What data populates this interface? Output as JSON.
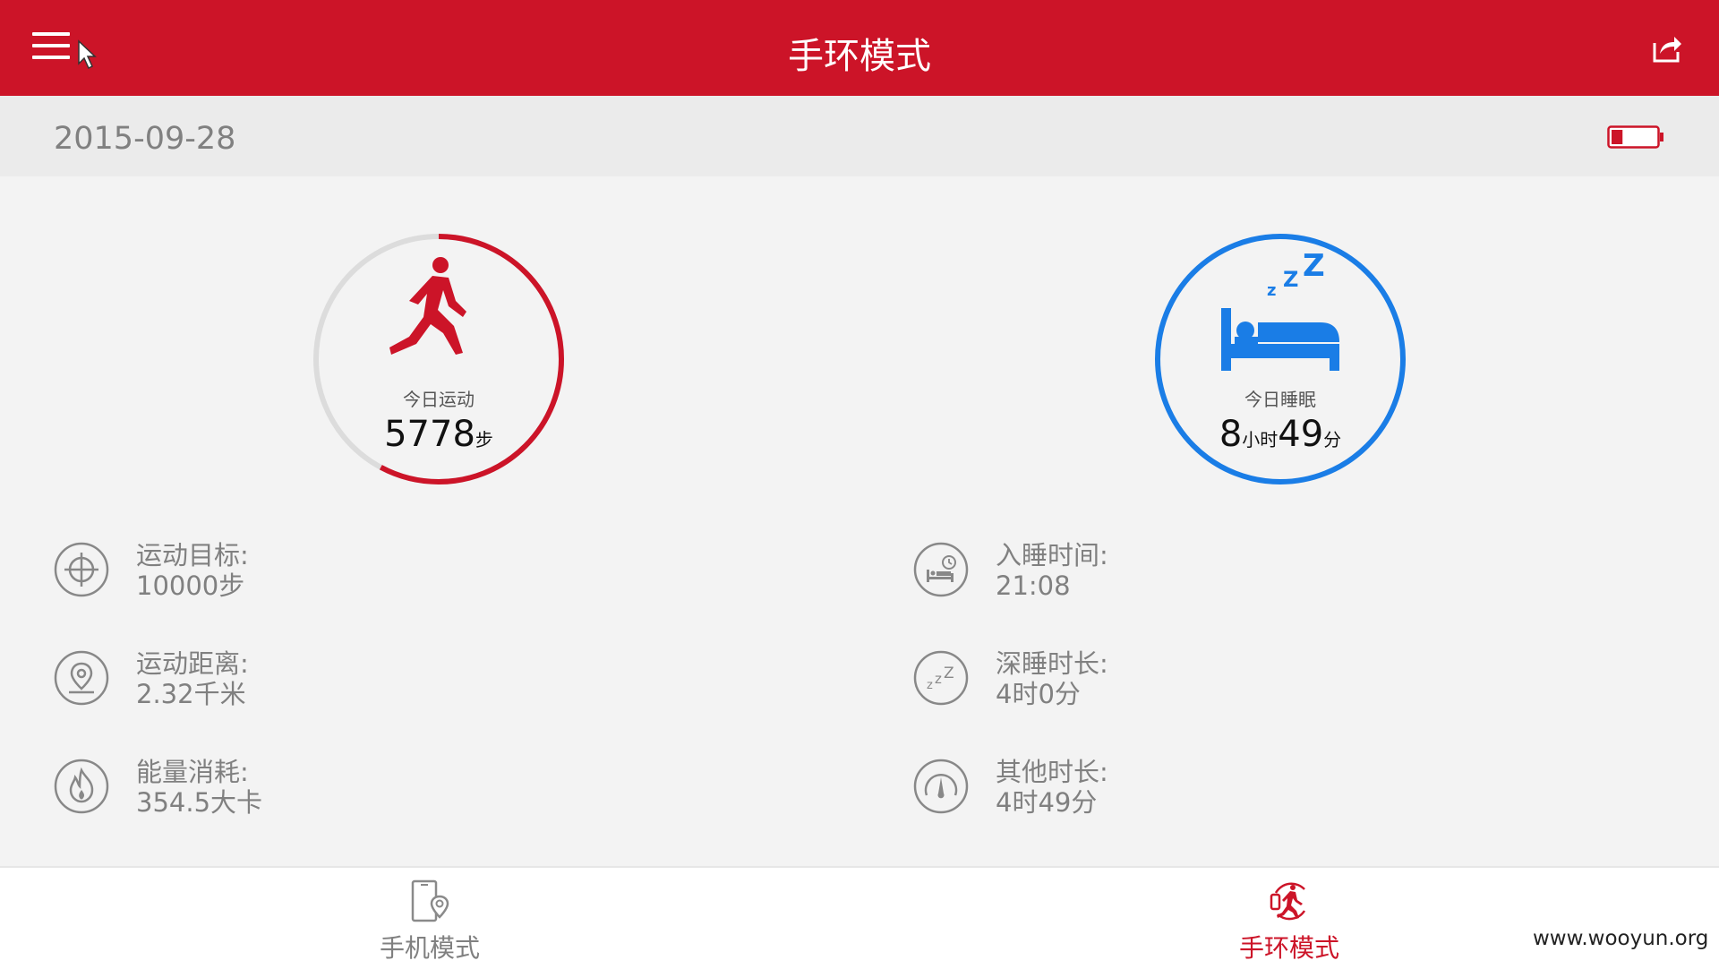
{
  "header": {
    "title": "手环模式"
  },
  "date_bar": {
    "date": "2015-09-28",
    "battery_level": 0.25
  },
  "activity": {
    "label": "今日运动",
    "steps": "5778",
    "steps_unit": "步",
    "progress": 0.578,
    "color": "#cc1428"
  },
  "sleep": {
    "label": "今日睡眠",
    "hours": "8",
    "hours_unit": "小时",
    "minutes": "49",
    "minutes_unit": "分",
    "color": "#1a7de6"
  },
  "activity_stats": [
    {
      "icon": "target-icon",
      "label": "运动目标:",
      "value": "10000步"
    },
    {
      "icon": "location-pin-icon",
      "label": "运动距离:",
      "value": "2.32千米"
    },
    {
      "icon": "flame-icon",
      "label": "能量消耗:",
      "value": "354.5大卡"
    }
  ],
  "sleep_stats": [
    {
      "icon": "bed-clock-icon",
      "label": "入睡时间:",
      "value": "21:08"
    },
    {
      "icon": "zzz-icon",
      "label": "深睡时长:",
      "value": "4时0分"
    },
    {
      "icon": "gauge-icon",
      "label": "其他时长:",
      "value": "4时49分"
    }
  ],
  "bottom_nav": [
    {
      "icon": "phone-location-icon",
      "label": "手机模式",
      "active": false
    },
    {
      "icon": "band-runner-icon",
      "label": "手环模式",
      "active": true
    }
  ],
  "watermark": "www.wooyun.org",
  "colors": {
    "brand_red": "#cc1428",
    "sleep_blue": "#1a7de6",
    "inactive_gray": "#808080"
  }
}
